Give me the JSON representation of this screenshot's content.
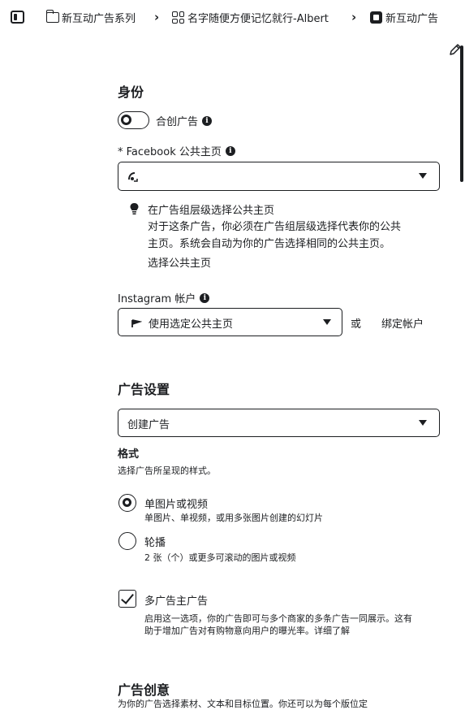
{
  "breadcrumb": {
    "campaign": "新互动广告系列",
    "adset": "名字随便方便记忆就行-Albert",
    "ad": "新互动广告"
  },
  "identity": {
    "title": "身份",
    "partnership_label": "合创广告",
    "facebook_label": "* Facebook 公共主页",
    "facebook_value": "",
    "notice_title": "在广告组层级选择公共主页",
    "notice_line1": "对于这条广告，你必须在广告组层级选择代表你的公共",
    "notice_line2": "主页。系统会自动为你的广告选择相同的公共主页。",
    "notice_link": "选择公共主页",
    "instagram_label": "Instagram 帐户",
    "instagram_value": "使用选定公共主页",
    "or_text": "或",
    "bind_account": "绑定帐户"
  },
  "ad_setup": {
    "title": "广告设置",
    "creation_value": "创建广告",
    "format_title": "格式",
    "format_desc": "选择广告所呈现的样式。",
    "options": [
      {
        "label": "单图片或视频",
        "desc": "单图片、单视频，或用多张图片创建的幻灯片",
        "selected": true
      },
      {
        "label": "轮播",
        "desc": "2 张（个）或更多可滚动的图片或视频",
        "selected": false
      }
    ],
    "multi_advertiser_label": "多广告主广告",
    "multi_advertiser_checked": true,
    "multi_line1": "启用这一选项，你的广告即可与多个商家的多条广告一同展示。这有",
    "multi_line2": "助于增加广告对有购物意向用户的曝光率。详细了解"
  },
  "creative": {
    "title": "广告创意",
    "desc": "为你的广告选择素材、文本和目标位置。你还可以为每个版位定"
  }
}
